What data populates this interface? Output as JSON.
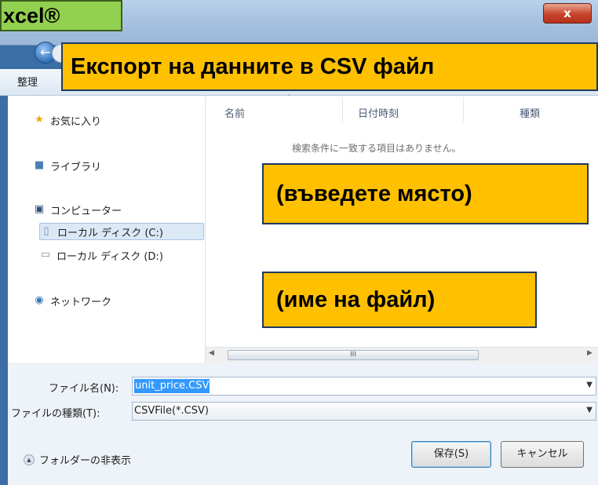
{
  "badge": {
    "label": "xcel®"
  },
  "titlebar": {
    "close_glyph": "x"
  },
  "toolbar": {
    "organize_label": "整理"
  },
  "callouts": {
    "title": "Експорт на данните в CSV файл",
    "place": "(въведете място)",
    "filename": "(име на файл)"
  },
  "nav": {
    "favorites": "お気に入り",
    "libraries": "ライブラリ",
    "computer": "コンピューター",
    "disk_c": "ローカル ディスク (C:)",
    "disk_d": "ローカル ディスク (D:)",
    "network": "ネットワーク"
  },
  "columns": {
    "name": "名前",
    "date": "日付時刻",
    "type": "種類"
  },
  "empty_message": "検索条件に一致する項目はありません。",
  "scroll": {
    "thumb_grip": "III"
  },
  "save_form": {
    "filename_label": "ファイル名(N):",
    "filename_value": "unit_price.CSV",
    "filetype_label": "ファイルの種類(T):",
    "filetype_value": "CSVFile(*.CSV)"
  },
  "footer": {
    "hide_folders": "フォルダーの非表示",
    "save_button": "保存(S)",
    "cancel_button": "キャンセル"
  },
  "colors": {
    "callout_fill": "#ffc000",
    "callout_border": "#1f3864",
    "badge_fill": "#92d050",
    "selection": "#3399ff"
  }
}
